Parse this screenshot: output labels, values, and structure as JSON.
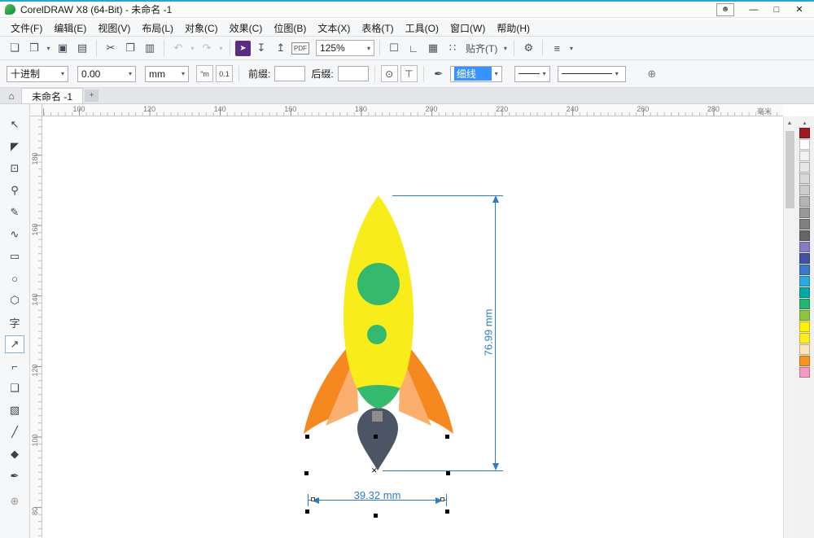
{
  "window": {
    "title": "CorelDRAW X8 (64-Bit) - 未命名 -1"
  },
  "menu_bar": {
    "items": [
      "文件(F)",
      "编辑(E)",
      "视图(V)",
      "布局(L)",
      "对象(C)",
      "效果(C)",
      "位图(B)",
      "文本(X)",
      "表格(T)",
      "工具(O)",
      "窗口(W)",
      "帮助(H)"
    ]
  },
  "standard_toolbar": {
    "zoom_value": "125%",
    "pdf_label": "PDF",
    "snap_label": "贴齐(T)"
  },
  "property_bar": {
    "dimension_style": "十进制",
    "dimension_precision": "0.00",
    "dimension_units": "mm",
    "show_units_label": "″m",
    "leading_zero_label": "0.1",
    "prefix_label": "前缀:",
    "prefix_value": "",
    "suffix_label": "后缀:",
    "suffix_value": "",
    "outline_width_value": "细线"
  },
  "document_tabs": {
    "active_tab": "未命名 -1",
    "new_tab_label": "+"
  },
  "rulers": {
    "horizontal_labels": [
      "100",
      "120",
      "140",
      "160",
      "180",
      "200",
      "220",
      "240",
      "260",
      "280"
    ],
    "vertical_labels": [
      "180",
      "160",
      "140",
      "120",
      "100",
      "80"
    ],
    "unit_indicator": "毫米"
  },
  "toolbox": {
    "items": [
      {
        "name": "pick-tool",
        "glyph": "↖",
        "selected": false
      },
      {
        "name": "shape-tool",
        "glyph": "◤",
        "selected": false
      },
      {
        "name": "crop-tool",
        "glyph": "⊡",
        "selected": false
      },
      {
        "name": "zoom-tool",
        "glyph": "⚲",
        "selected": false
      },
      {
        "name": "freehand-tool",
        "glyph": "✎",
        "selected": false
      },
      {
        "name": "artistic-media-tool",
        "glyph": "∿",
        "selected": false
      },
      {
        "name": "rectangle-tool",
        "glyph": "▭",
        "selected": false
      },
      {
        "name": "ellipse-tool",
        "glyph": "○",
        "selected": false
      },
      {
        "name": "polygon-tool",
        "glyph": "⬡",
        "selected": false
      },
      {
        "name": "text-tool",
        "glyph": "字",
        "selected": false
      },
      {
        "name": "parallel-dimension-tool",
        "glyph": "↗",
        "selected": true
      },
      {
        "name": "connector-tool",
        "glyph": "⌐",
        "selected": false
      },
      {
        "name": "drop-shadow-tool",
        "glyph": "❑",
        "selected": false
      },
      {
        "name": "transparency-tool",
        "glyph": "▧",
        "selected": false
      },
      {
        "name": "eyedropper-tool",
        "glyph": "╱",
        "selected": false
      },
      {
        "name": "fill-tool",
        "glyph": "◆",
        "selected": false
      },
      {
        "name": "outline-tool",
        "glyph": "✒",
        "selected": false
      },
      {
        "name": "quick-customize-button",
        "glyph": "⊕",
        "selected": false
      }
    ]
  },
  "color_palette": {
    "colors": [
      "#9e1b1f",
      "#ffffff",
      "#f2f2f2",
      "#e6e6e6",
      "#d9d9d9",
      "#cccccc",
      "#b3b3b3",
      "#999999",
      "#808080",
      "#666666",
      "#8a7bc8",
      "#3f51a3",
      "#3b78c9",
      "#29abe2",
      "#00a9a5",
      "#22b573",
      "#8cc63f",
      "#fff200",
      "#fcee21",
      "#fbe5b9",
      "#f7931e",
      "#f49ac1"
    ]
  },
  "drawing": {
    "height_dimension_label": "76.99 mm",
    "width_dimension_label": "39.32 mm",
    "center_mark": "✕",
    "colors": {
      "body": "#f8ec1a",
      "window_large": "#35b96e",
      "window_small": "#35b96e",
      "fin_dark": "#f5891f",
      "fin_light": "#fbaf6e",
      "tail_green": "#35b96e",
      "nozzle": "#4b5566",
      "nozzle_square": "#8d8d8d",
      "dimension": "#2b7cc4"
    }
  },
  "icons": {
    "account": "☻",
    "minimize": "—",
    "maximize": "□",
    "close": "✕",
    "new_document": "❏",
    "open": "❒",
    "save": "▣",
    "print": "▤",
    "cut": "✂",
    "copy": "❐",
    "paste": "▥",
    "undo": "↶",
    "redo": "↷",
    "launch": "➤",
    "import": "↧",
    "export": "↥",
    "fullscreen": "☐",
    "show_rulers": "∟",
    "show_grid": "▦",
    "snap_points": "∷",
    "options_gear": "⚙",
    "launcher": "≡",
    "caret": "▾",
    "home": "⌂",
    "dynamic_dimension": "⊙",
    "dimension_text_position": "⊤",
    "outline_pen": "✒",
    "node_align": "⊕",
    "scroll_up": "▲",
    "palette_scroll": "▴"
  }
}
